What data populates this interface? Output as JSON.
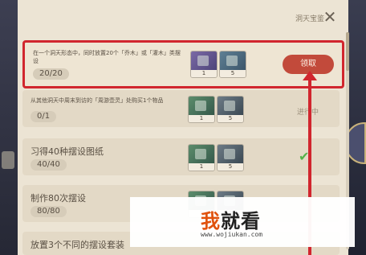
{
  "panel": {
    "title": "洞天宝鉴"
  },
  "tasks": [
    {
      "description": "在一个洞天形态中，同时放置20个「乔木」或「灌木」类摆设",
      "progress": "20/20",
      "rewards": [
        {
          "icon": "tree-furnishing-icon",
          "count": "1"
        },
        {
          "icon": "stone-pillar-icon",
          "count": "5"
        }
      ],
      "action": "领取"
    },
    {
      "description": "从其他洞天中周末到访的「周游壶灵」处购买1个物品",
      "progress": "0/1",
      "rewards": [
        {
          "icon": "fence-furnishing-icon",
          "count": "1"
        },
        {
          "icon": "stone-pillar-icon",
          "count": "5"
        }
      ],
      "status": "进行中"
    },
    {
      "description": "习得40种摆设图纸",
      "progress": "40/40",
      "rewards": [
        {
          "icon": "fence-furnishing-icon",
          "count": "1"
        },
        {
          "icon": "stone-pillar-icon",
          "count": "5"
        }
      ]
    },
    {
      "description": "制作80次摆设",
      "progress": "80/80",
      "rewards": [
        {
          "icon": "fence-furnishing-icon",
          "count": "1"
        },
        {
          "icon": "stone-pillar-icon",
          "count": "5"
        }
      ]
    },
    {
      "description": "放置3个不同的摆设套装"
    }
  ],
  "watermark": {
    "logo": "我就看",
    "logo_first": "我",
    "logo_rest": "就看",
    "url": "www.wojiukan.com"
  },
  "colors": {
    "highlight": "#d1262e",
    "claim_button": "#c24a3b",
    "check": "#55b24a"
  }
}
